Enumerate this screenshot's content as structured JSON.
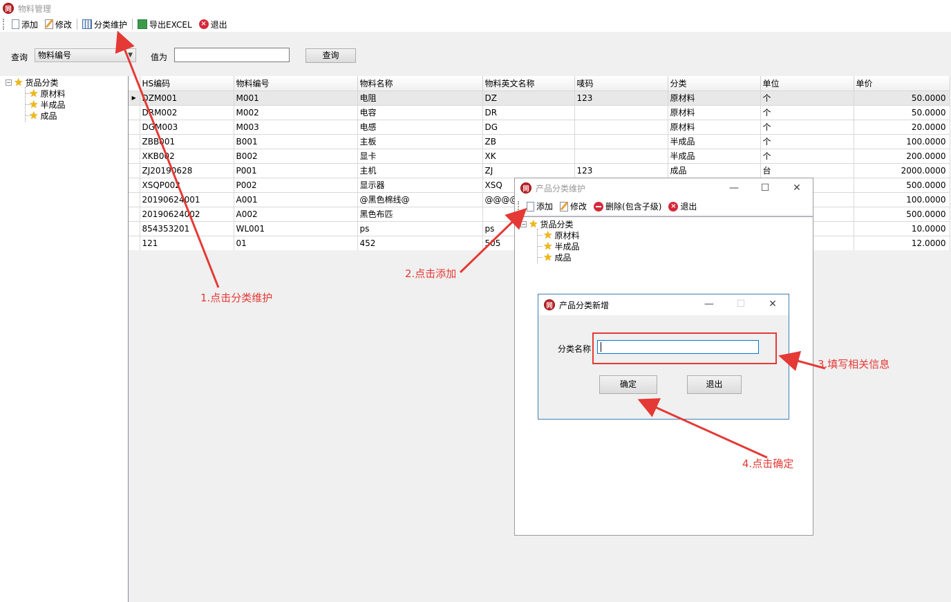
{
  "main_window": {
    "title": "物料管理",
    "logo_text": "同"
  },
  "toolbar": {
    "add": "添加",
    "edit": "修改",
    "category": "分类维护",
    "export": "导出EXCEL",
    "exit": "退出"
  },
  "query": {
    "label": "查询",
    "field_selected": "物料编号",
    "value_label": "值为",
    "value": "",
    "button": "查询"
  },
  "tree": {
    "root": "货品分类",
    "children": [
      "原材料",
      "半成品",
      "成品"
    ]
  },
  "grid": {
    "columns": [
      "HS编码",
      "物料编号",
      "物料名称",
      "物料英文名称",
      "唛码",
      "分类",
      "单位",
      "单价"
    ],
    "rows": [
      [
        "DZM001",
        "M001",
        "电阻",
        "DZ",
        "123",
        "原材料",
        "个",
        "50.0000"
      ],
      [
        "DRM002",
        "M002",
        "电容",
        "DR",
        "",
        "原材料",
        "个",
        "50.0000"
      ],
      [
        "DGM003",
        "M003",
        "电感",
        "DG",
        "",
        "原材料",
        "个",
        "20.0000"
      ],
      [
        "ZBB001",
        "B001",
        "主板",
        "ZB",
        "",
        "半成品",
        "个",
        "100.0000"
      ],
      [
        "XKB002",
        "B002",
        "显卡",
        "XK",
        "",
        "半成品",
        "个",
        "200.0000"
      ],
      [
        "ZJ20190628",
        "P001",
        "主机",
        "ZJ",
        "123",
        "成品",
        "台",
        "2000.0000"
      ],
      [
        "XSQP002",
        "P002",
        "显示器",
        "XSQ",
        "",
        "",
        "",
        "500.0000"
      ],
      [
        "20190624001",
        "A001",
        "@黑色棉线@",
        "@@@@",
        "",
        "",
        "",
        "100.0000"
      ],
      [
        "20190624002",
        "A002",
        "黑色布匹",
        "",
        "",
        "",
        "",
        "500.0000"
      ],
      [
        "854353201",
        "WL001",
        "ps",
        "ps",
        "",
        "",
        "",
        "10.0000"
      ],
      [
        "121",
        "01",
        "452",
        "505",
        "",
        "",
        "",
        "12.0000"
      ]
    ]
  },
  "category_window": {
    "title": "产品分类维护",
    "toolbar": {
      "add": "添加",
      "edit": "修改",
      "delete": "删除(包含子级)",
      "exit": "退出"
    },
    "tree": {
      "root": "货品分类",
      "children": [
        "原材料",
        "半成品",
        "成品"
      ]
    }
  },
  "add_dialog": {
    "title": "产品分类新增",
    "name_label": "分类名称",
    "name_value": "",
    "ok": "确定",
    "cancel": "退出"
  },
  "annotations": {
    "step1": "1.点击分类维护",
    "step2": "2.点击添加",
    "step3": "3.填写相关信息",
    "step4": "4.点击确定",
    "color": "#e53935"
  },
  "icons": {
    "min": "—",
    "max": "☐",
    "close": "✕"
  }
}
